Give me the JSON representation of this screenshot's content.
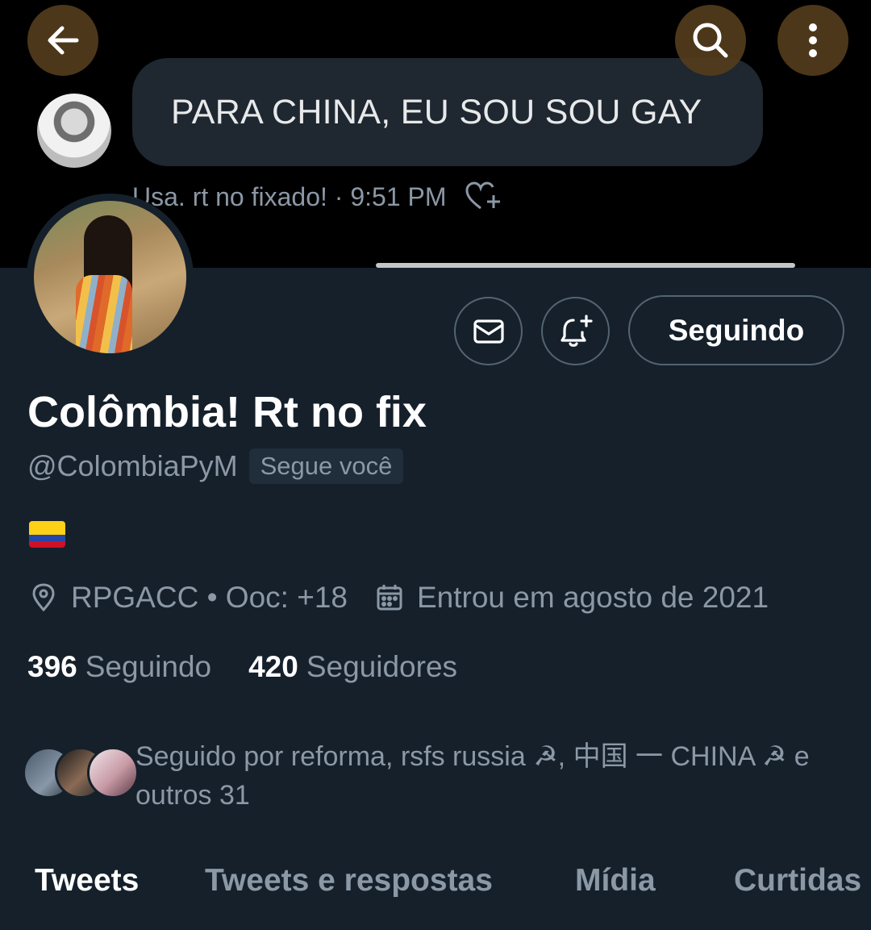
{
  "banner": {
    "message": "PARA CHINA, EU SOU SOU GAY",
    "meta": "Usa. rt no fixado! · 9:51 PM"
  },
  "top_bar": {
    "back_icon": "arrow-left-icon",
    "search_icon": "search-icon",
    "more_icon": "more-vertical-icon"
  },
  "actions": {
    "message_icon": "envelope-icon",
    "notify_icon": "bell-plus-icon",
    "follow_label": "Seguindo"
  },
  "profile": {
    "display_name": "Colômbia! Rt no fix",
    "handle": "@ColombiaPyM",
    "follows_you": "Segue você",
    "bio_flag": "colombia-flag",
    "location": "RPGACC • Ooc: +18",
    "joined": "Entrou em agosto de 2021",
    "following_count": "396",
    "following_label": "Seguindo",
    "followers_count": "420",
    "followers_label": "Seguidores",
    "followed_by": "Seguido por reforma, rsfs russia ☭, 中国 一 CHINA ☭ e outros 31"
  },
  "tabs": [
    {
      "label": "Tweets",
      "active": true
    },
    {
      "label": "Tweets e respostas",
      "active": false
    },
    {
      "label": "Mídia",
      "active": false
    },
    {
      "label": "Curtidas",
      "active": false
    }
  ],
  "colors": {
    "background": "#15202b",
    "text_secondary": "#8b98a5",
    "border": "#536471",
    "overlay_button": "#543c1c"
  }
}
